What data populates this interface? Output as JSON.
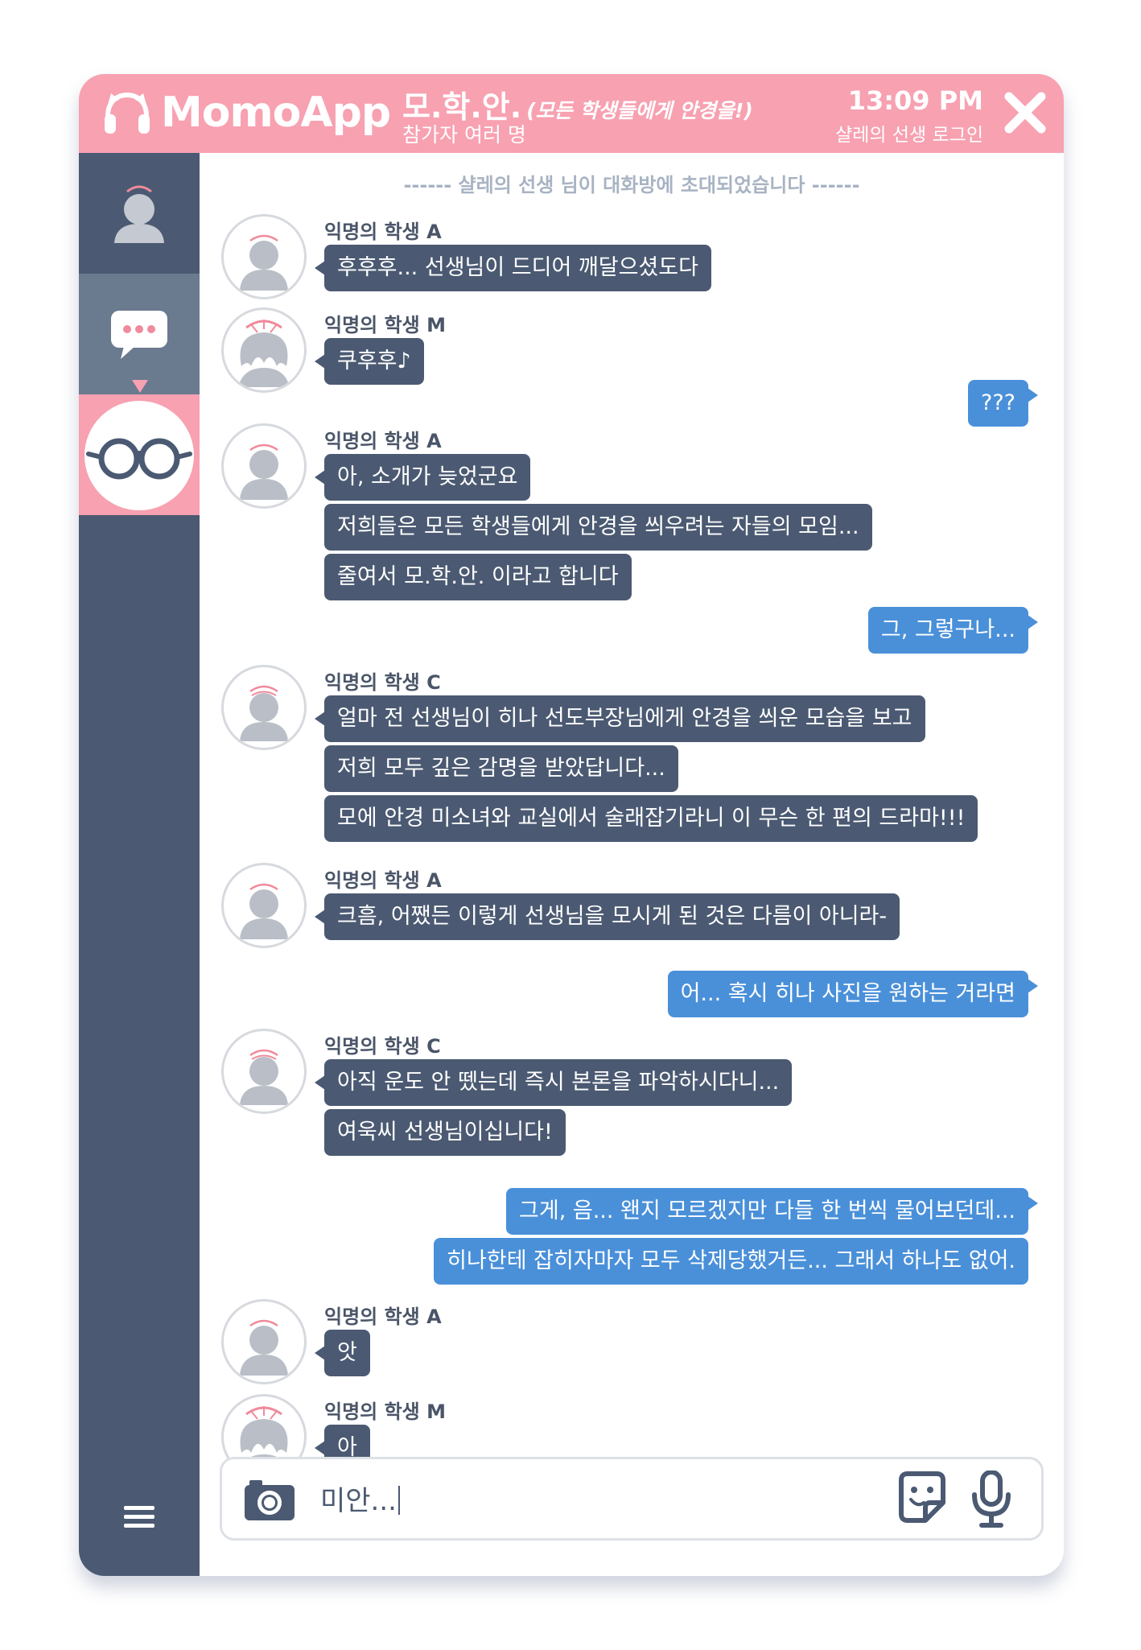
{
  "app": {
    "name": "MomoApp",
    "room_title": "모.학.안.",
    "room_tagline": "(모든 학생들에게 안경을!)",
    "participants": "참가자 여러 명",
    "time": "13:09 PM",
    "login_status": "샬레의 선생 로그인"
  },
  "chat": {
    "system_notice": "------ 샬레의 선생 님이 대화방에 초대되었습니다 ------",
    "groups": [
      {
        "sender": "익명의 학생 A",
        "messages": [
          "후후후... 선생님이 드디어 깨달으셨도다"
        ]
      },
      {
        "sender": "익명의 학생 M",
        "messages": [
          "쿠후후♪"
        ]
      },
      {
        "sent": [
          "???"
        ]
      },
      {
        "sender": "익명의 학생 A",
        "messages": [
          "아, 소개가 늦었군요",
          "저희들은 모든 학생들에게 안경을 씌우려는 자들의 모임...",
          "줄여서 모.학.안. 이라고 합니다"
        ]
      },
      {
        "sent": [
          "그, 그렇구나..."
        ]
      },
      {
        "sender": "익명의 학생 C",
        "messages": [
          "얼마 전 선생님이 히나 선도부장님에게 안경을 씌운 모습을 보고",
          "저희 모두 깊은 감명을 받았답니다...",
          "모에 안경 미소녀와 교실에서 술래잡기라니 이 무슨 한 편의 드라마!!!"
        ]
      },
      {
        "sender": "익명의 학생 A",
        "messages": [
          "크흠, 어쨌든 이렇게 선생님을 모시게 된 것은 다름이 아니라-"
        ]
      },
      {
        "sent": [
          "어... 혹시 히나 사진을 원하는 거라면"
        ]
      },
      {
        "sender": "익명의 학생 C",
        "messages": [
          "아직 운도 안 뗐는데 즉시 본론을 파악하시다니...",
          "여욱씨 선생님이십니다!"
        ]
      },
      {
        "sent": [
          "그게, 음... 왠지 모르겠지만 다들 한 번씩 물어보던데...",
          "히나한테 잡히자마자 모두 삭제당했거든... 그래서 하나도 없어."
        ]
      },
      {
        "sender": "익명의 학생 A",
        "messages": [
          "앗"
        ]
      },
      {
        "sender": "익명의 학생 M",
        "messages": [
          "아"
        ]
      }
    ]
  },
  "input": {
    "value": "미안..."
  },
  "colors": {
    "accent_pink": "#f7a1b1",
    "sidebar_navy": "#4b5a72",
    "sent_blue": "#4a90d9",
    "received_bubble": "#4b5a72"
  },
  "icons": [
    "headphones-icon",
    "close-icon",
    "profile-icon",
    "chat-bubble-icon",
    "glasses-icon",
    "menu-icon",
    "camera-icon",
    "sticker-icon",
    "microphone-icon"
  ]
}
